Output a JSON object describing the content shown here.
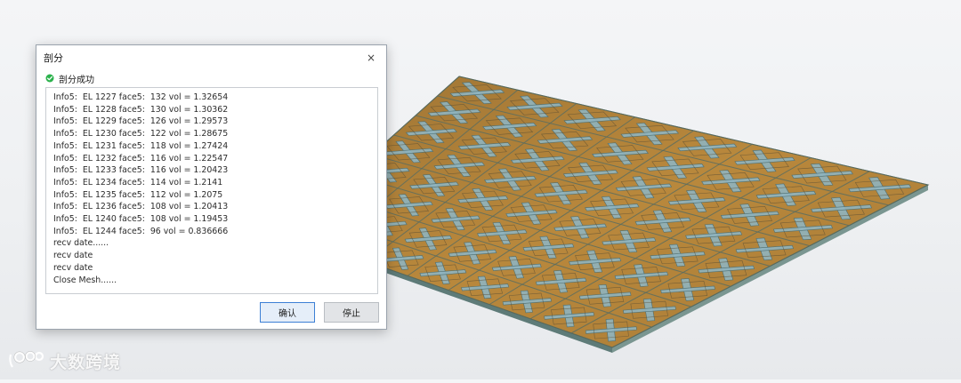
{
  "dialog": {
    "title": "剖分",
    "close_symbol": "×",
    "status": {
      "icon": "check-circle-icon",
      "color": "#2bb24c",
      "text": "剖分成功"
    },
    "log_lines": [
      "Info5:  EL 1227 face5:  132 vol = 1.32654",
      "Info5:  EL 1228 face5:  130 vol = 1.30362",
      "Info5:  EL 1229 face5:  126 vol = 1.29573",
      "Info5:  EL 1230 face5:  122 vol = 1.28675",
      "Info5:  EL 1231 face5:  118 vol = 1.27424",
      "Info5:  EL 1232 face5:  116 vol = 1.22547",
      "Info5:  EL 1233 face5:  116 vol = 1.20423",
      "Info5:  EL 1234 face5:  114 vol = 1.2141",
      "Info5:  EL 1235 face5:  112 vol = 1.2075",
      "Info5:  EL 1236 face5:  108 vol = 1.20413",
      "Info5:  EL 1240 face5:  108 vol = 1.19453",
      "Info5:  EL 1244 face5:  96 vol = 0.836666",
      "recv date......",
      "recv date",
      "recv date",
      "Close Mesh......"
    ],
    "buttons": {
      "ok_label": "确认",
      "stop_label": "停止"
    }
  },
  "viewport": {
    "model": "antenna-array-mesh",
    "colors": {
      "substrate": "#b8863a",
      "patch": "#8fb4bf",
      "edge": "#6f8a84"
    }
  },
  "watermark": {
    "icon": "dashuju-logo-icon",
    "text": "大数跨境"
  }
}
